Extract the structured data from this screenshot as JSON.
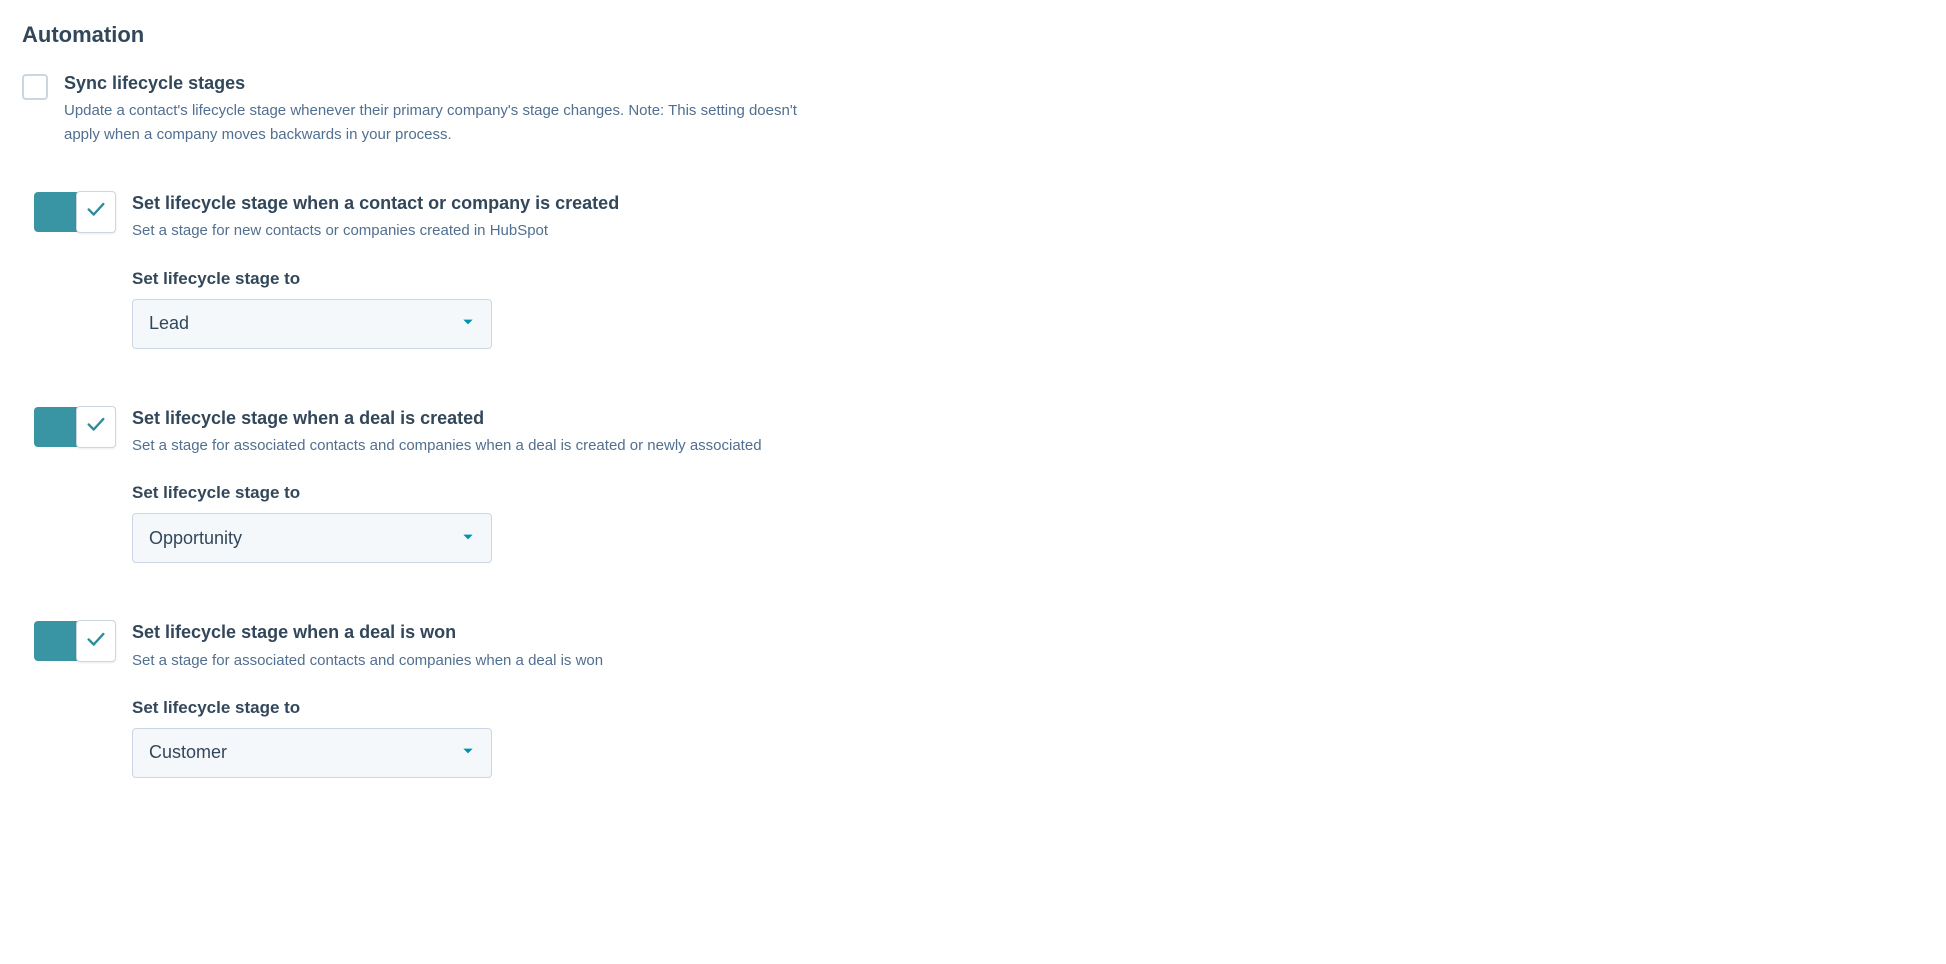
{
  "colors": {
    "text_primary": "#33475b",
    "text_secondary": "#516f90",
    "toggle_on_bg": "#3994a3",
    "check_stroke": "#2e8b9b",
    "caret_fill": "#0091ae",
    "border": "#cbd6e2",
    "select_bg": "#f5f8fa"
  },
  "heading": "Automation",
  "sync": {
    "title": "Sync lifecycle stages",
    "description": "Update a contact's lifecycle stage whenever their primary company's stage changes. Note: This setting doesn't apply when a company moves backwards in your process.",
    "checked": false
  },
  "rules": [
    {
      "title": "Set lifecycle stage when a contact or company is created",
      "description": "Set a stage for new contacts or companies created in HubSpot",
      "select_label": "Set lifecycle stage to",
      "select_value": "Lead",
      "toggle_on": true
    },
    {
      "title": "Set lifecycle stage when a deal is created",
      "description": "Set a stage for associated contacts and companies when a deal is created or newly associated",
      "select_label": "Set lifecycle stage to",
      "select_value": "Opportunity",
      "toggle_on": true
    },
    {
      "title": "Set lifecycle stage when a deal is won",
      "description": "Set a stage for associated contacts and companies when a deal is won",
      "select_label": "Set lifecycle stage to",
      "select_value": "Customer",
      "toggle_on": true
    }
  ]
}
